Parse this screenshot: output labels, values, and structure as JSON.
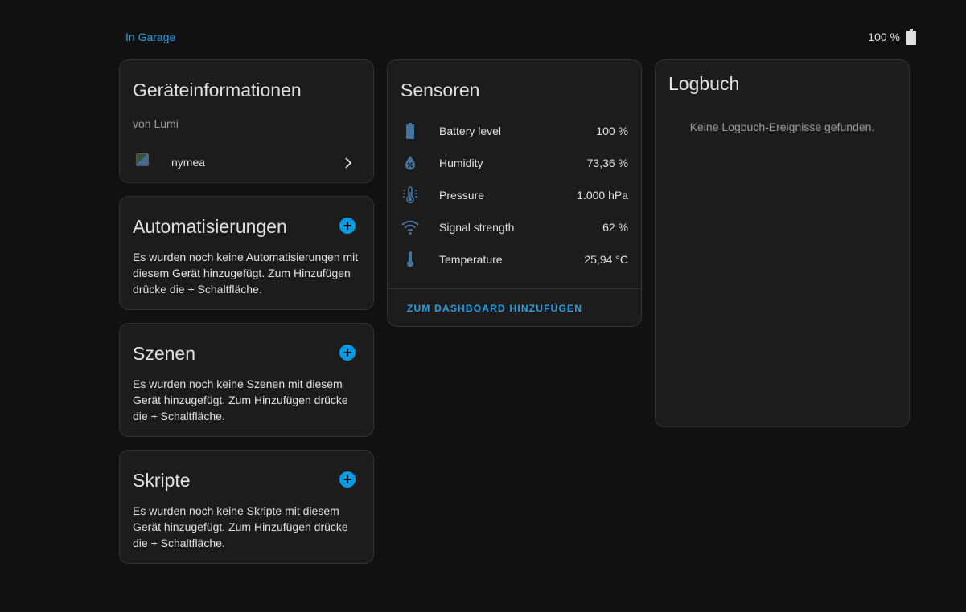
{
  "header": {
    "area_link": "In Garage",
    "battery_text": "100 %"
  },
  "device_info": {
    "title": "Geräteinformationen",
    "manufacturer": "von Lumi",
    "integration": "nymea"
  },
  "automations": {
    "title": "Automatisierungen",
    "text": "Es wurden noch keine Automatisierungen mit diesem Gerät hinzugefügt. Zum Hinzufügen drücke die + Schaltfläche."
  },
  "scenes": {
    "title": "Szenen",
    "text": "Es wurden noch keine Szenen mit diesem Gerät hinzugefügt. Zum Hinzufügen drücke die + Schaltfläche."
  },
  "scripts": {
    "title": "Skripte",
    "text": "Es wurden noch keine Skripte mit diesem Gerät hinzugefügt. Zum Hinzufügen drücke die + Schaltfläche."
  },
  "sensors": {
    "title": "Sensoren",
    "items": [
      {
        "icon": "battery-icon",
        "name": "Battery level",
        "value": "100 %"
      },
      {
        "icon": "water-percent-icon",
        "name": "Humidity",
        "value": "73,36 %"
      },
      {
        "icon": "gauge-thermometer-icon",
        "name": "Pressure",
        "value": "1.000 hPa"
      },
      {
        "icon": "wifi-icon",
        "name": "Signal strength",
        "value": "62 %"
      },
      {
        "icon": "thermometer-icon",
        "name": "Temperature",
        "value": "25,94 °C"
      }
    ],
    "dashboard_button": "ZUM DASHBOARD HINZUFÜGEN"
  },
  "logbook": {
    "title": "Logbuch",
    "empty_text": "Keine Logbuch-Ereignisse gefunden."
  },
  "colors": {
    "accent": "#039be5",
    "icon": "#44739e",
    "background": "#111111",
    "card": "#1c1c1c"
  }
}
